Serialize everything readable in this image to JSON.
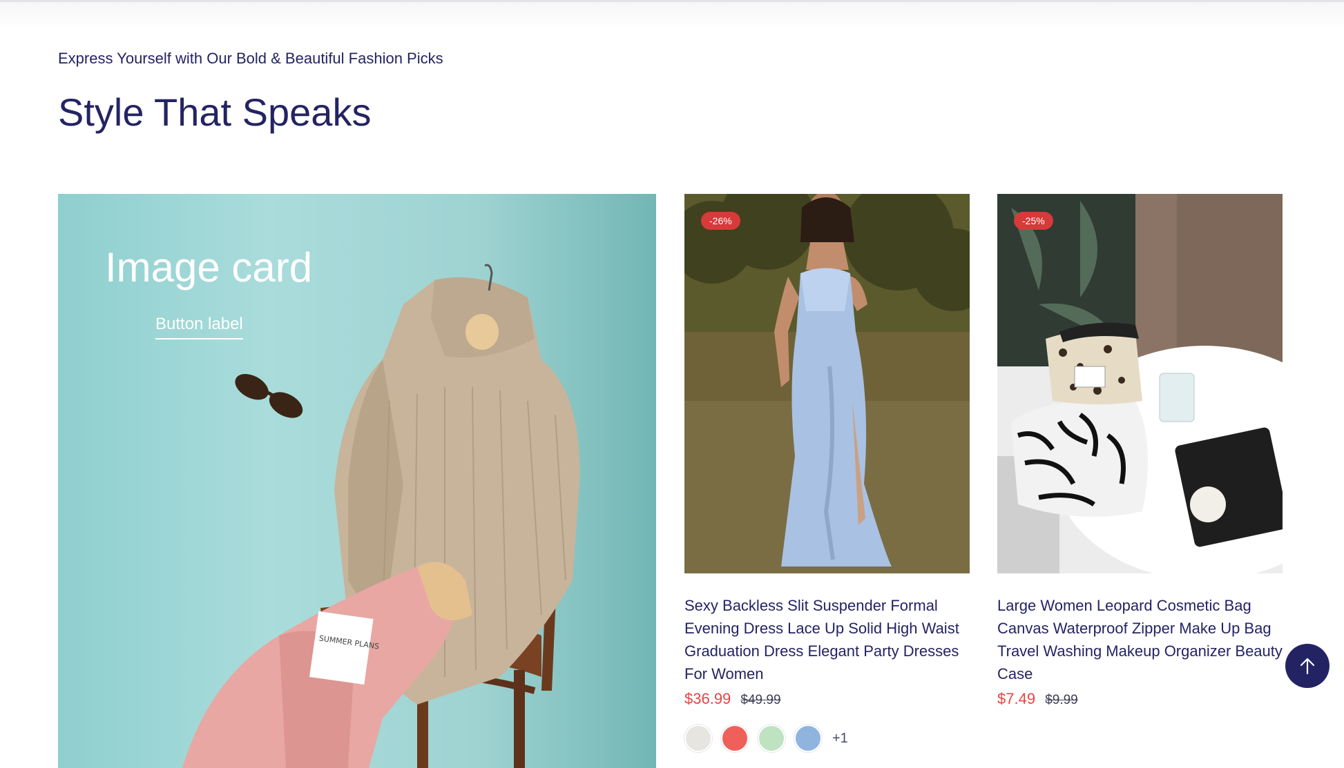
{
  "section": {
    "subtitle": "Express Yourself with Our Bold & Beautiful Fashion Picks",
    "title": "Style That Speaks"
  },
  "image_card": {
    "title": "Image card",
    "button_label": "Button label",
    "notepad_text": "SUMMER PLANS"
  },
  "products": [
    {
      "badge": "-26%",
      "title": "Sexy Backless Slit Suspender Formal Evening Dress Lace Up Solid High Waist Graduation Dress Elegant Party Dresses For Women",
      "price": "$36.99",
      "compare_price": "$49.99",
      "swatches": [
        "#e7e5df",
        "#f0605a",
        "#bfe3c1",
        "#8fb4de"
      ],
      "more_swatches": "+1"
    },
    {
      "badge": "-25%",
      "title": "Large Women Leopard Cosmetic Bag Canvas Waterproof Zipper Make Up Bag Travel Washing Makeup Organizer Beauty Case",
      "price": "$7.49",
      "compare_price": "$9.99"
    }
  ],
  "colors": {
    "primary": "#232364",
    "sale": "#e54444",
    "badge": "#d63a3a"
  },
  "icons": {
    "back_to_top": "arrow-up-icon"
  }
}
